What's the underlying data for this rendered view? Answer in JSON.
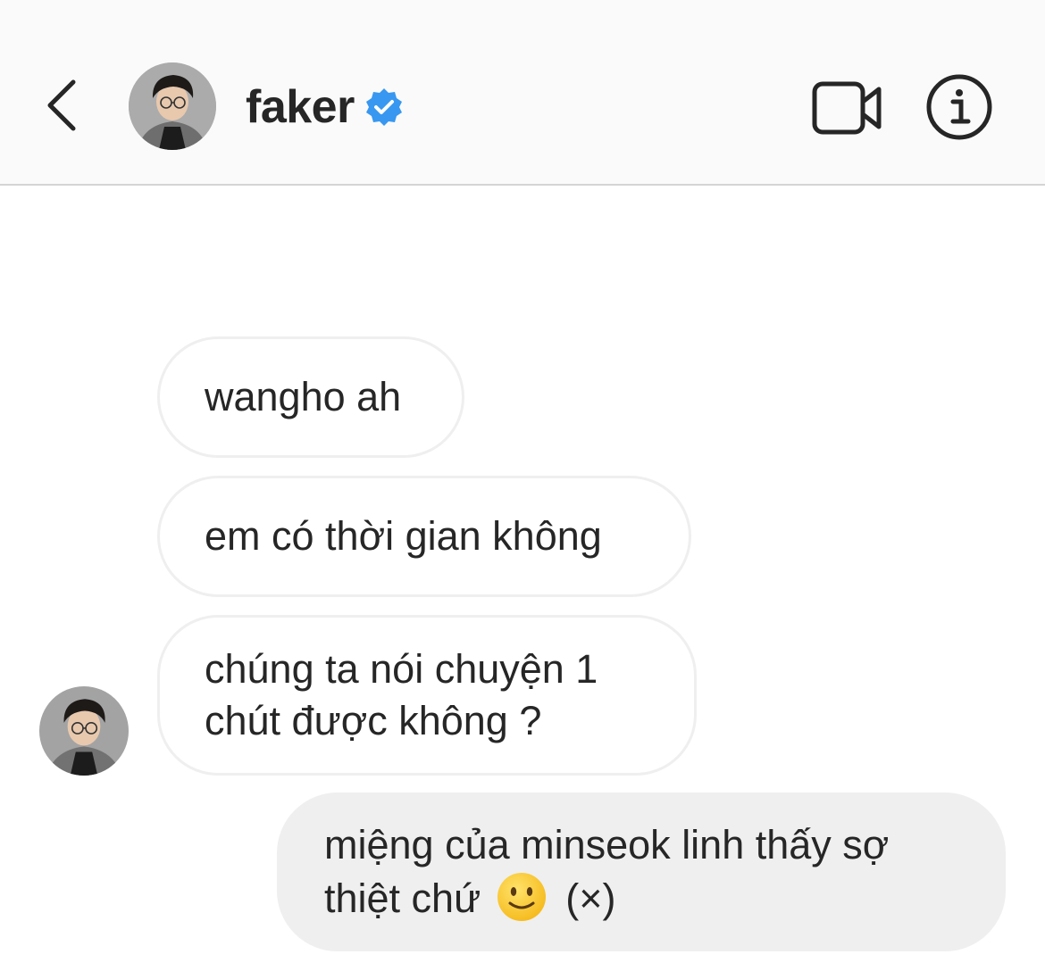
{
  "header": {
    "username": "faker",
    "verified": true,
    "icons": {
      "back": "chevron-left-icon",
      "verified": "verified-badge-icon",
      "video": "video-camera-icon",
      "info": "info-icon"
    },
    "accent_color": "#3897f0"
  },
  "messages": [
    {
      "sender": "faker",
      "text": "wangho ah"
    },
    {
      "sender": "faker",
      "text": "em có thời gian không"
    },
    {
      "sender": "faker",
      "line1": "chúng ta nói chuyện 1",
      "line2": "chút được không ?"
    },
    {
      "sender": "me",
      "line1": "miệng của minseok linh thấy sợ",
      "line2_a": "thiệt chứ",
      "emoji": "slightly-smiling-face-icon",
      "line2_b": "(×)"
    }
  ]
}
